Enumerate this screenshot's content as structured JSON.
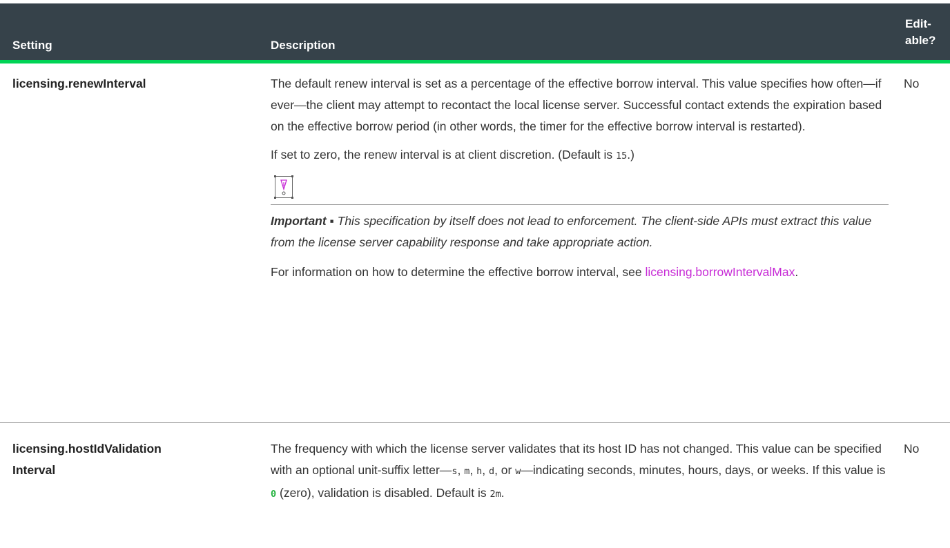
{
  "header": {
    "setting": "Setting",
    "description": "Description",
    "editable": "Edit-\nable?"
  },
  "rows": [
    {
      "setting": "licensing.renewInterval",
      "editable": "No",
      "para1": "The default renew interval is set as a percentage of the effective borrow interval. This value specifies how often—if ever—the client may attempt to recontact the local license server. Successful contact extends the expiration based on the effective borrow period (in other words, the timer for the effective borrow interval is restarted).",
      "para2_before": "If set to zero, the renew interval is at client discretion. (Default is ",
      "para2_code": "15",
      "para2_after": ".)",
      "note_label": "Important ▪",
      "note_text": " This specification by itself does not lead to enforcement. The client-side APIs must extract this value from the license server capability response and take appropriate action.",
      "para4_before": "For information on how to determine the effective borrow interval, see ",
      "para4_link": "licensing.borrowIntervalMax",
      "para4_after": "."
    },
    {
      "setting": "licensing.hostIdValidation\nInterval",
      "editable": "No",
      "t1": "The frequency with which the license server validates that its host ID has not changed. This value can be specified with an optional unit-suffix letter—",
      "c_s": "s",
      "sep1": ", ",
      "c_m": "m",
      "sep2": ", ",
      "c_h": "h",
      "sep3": ", ",
      "c_d": "d",
      "sep4": ", or ",
      "c_w": "w",
      "t2": "—indicating seconds, minutes, hours, days, or weeks. If this value is ",
      "c_zero": "0",
      "t3": " (zero), validation is disabled. Default is ",
      "c_default": " 2m",
      "t4": "."
    }
  ],
  "icons": {
    "note": "important-note-icon"
  }
}
